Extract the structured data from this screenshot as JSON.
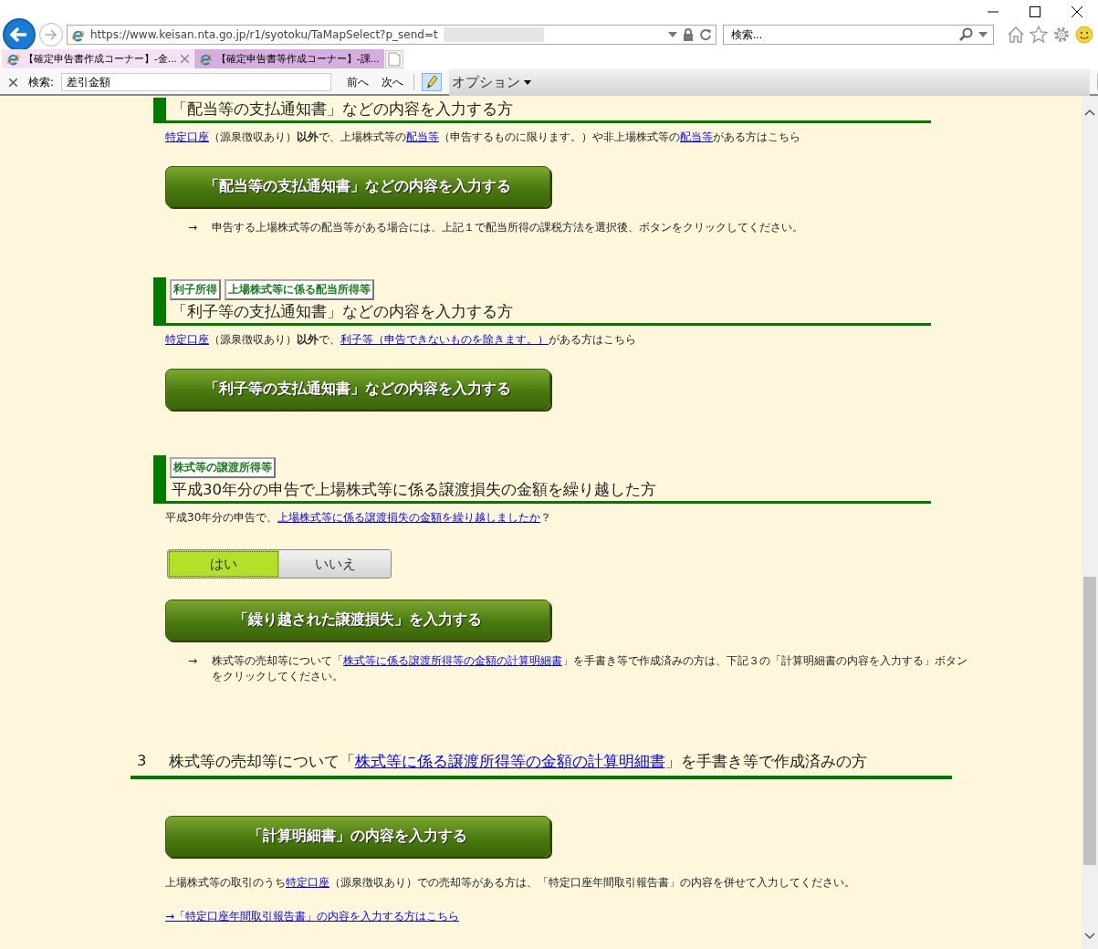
{
  "address_bar": {
    "url": "https://www.keisan.nta.go.jp/r1/syotoku/TaMapSelect?p_send=t"
  },
  "search_box": {
    "placeholder": "検索..."
  },
  "tabs": [
    {
      "title": "【確定申告書作成コーナー】-金...",
      "selected": true,
      "closable": true
    },
    {
      "title": "【確定申告書等作成コーナー】-課...",
      "selected": false,
      "closable": false
    }
  ],
  "find_bar": {
    "label": "検索:",
    "value": "差引金額",
    "prev": "前へ",
    "next": "次へ",
    "options": "オプション"
  },
  "sections": [
    {
      "blocks": [
        {
          "kind": "heading",
          "title": "「配当等の支払通知書」などの内容を入力する方"
        },
        {
          "kind": "paragraph",
          "segments": [
            {
              "kind": "link",
              "text": "特定口座"
            },
            {
              "kind": "text",
              "text": "（源泉徴収あり）"
            },
            {
              "kind": "bold",
              "text": "以外"
            },
            {
              "kind": "text",
              "text": "で、上場株式等の"
            },
            {
              "kind": "link",
              "text": "配当等"
            },
            {
              "kind": "text",
              "text": "（申告するものに限ります。）や非上場株式等の"
            },
            {
              "kind": "link",
              "text": "配当等"
            },
            {
              "kind": "text",
              "text": "がある方はこちら"
            }
          ]
        },
        {
          "kind": "button",
          "label": "「配当等の支払通知書」などの内容を入力する"
        },
        {
          "kind": "note",
          "arrow": "→",
          "segments": [
            {
              "kind": "text",
              "text": "申告する上場株式等の配当等がある場合には、上記１で配当所得の課税方法を選択後、ボタンをクリックしてください。"
            }
          ]
        }
      ]
    },
    {
      "blocks": [
        {
          "kind": "heading",
          "tags": [
            "利子所得",
            "上場株式等に係る配当所得等"
          ],
          "title": "「利子等の支払通知書」などの内容を入力する方"
        },
        {
          "kind": "paragraph",
          "segments": [
            {
              "kind": "link",
              "text": "特定口座"
            },
            {
              "kind": "text",
              "text": "（源泉徴収あり）"
            },
            {
              "kind": "bold",
              "text": "以外"
            },
            {
              "kind": "text",
              "text": "で、"
            },
            {
              "kind": "link",
              "text": "利子等（申告できないものを除きます。）"
            },
            {
              "kind": "text",
              "text": "がある方はこちら"
            }
          ]
        },
        {
          "kind": "button",
          "label": "「利子等の支払通知書」などの内容を入力する"
        }
      ]
    },
    {
      "blocks": [
        {
          "kind": "heading",
          "tags": [
            "株式等の譲渡所得等"
          ],
          "title": "平成30年分の申告で上場株式等に係る譲渡損失の金額を繰り越した方"
        },
        {
          "kind": "paragraph",
          "segments": [
            {
              "kind": "text",
              "text": "平成30年分の申告で、"
            },
            {
              "kind": "link",
              "text": "上場株式等に係る譲渡損失の金額を繰り越しましたか"
            },
            {
              "kind": "text",
              "text": "？"
            }
          ]
        },
        {
          "kind": "toggle",
          "options": [
            {
              "label": "はい",
              "selected": true
            },
            {
              "label": "いいえ",
              "selected": false
            }
          ]
        },
        {
          "kind": "button",
          "label": "「繰り越された譲渡損失」を入力する"
        },
        {
          "kind": "note",
          "arrow": "→",
          "segments": [
            {
              "kind": "text",
              "text": "株式等の売却等について「"
            },
            {
              "kind": "link",
              "text": "株式等に係る譲渡所得等の金額の計算明細書"
            },
            {
              "kind": "text",
              "text": "」を手書き等で作成済みの方は、下記３の「計算明細書の内容を入力する」ボタンをクリックしてください。"
            }
          ]
        }
      ]
    },
    {
      "blocks": [
        {
          "kind": "numbered",
          "number": "3",
          "segments": [
            {
              "kind": "text",
              "text": "株式等の売却等について「"
            },
            {
              "kind": "link",
              "text": "株式等に係る譲渡所得等の金額の計算明細書"
            },
            {
              "kind": "text",
              "text": "」を手書き等で作成済みの方"
            }
          ]
        },
        {
          "kind": "button",
          "label": "「計算明細書」の内容を入力する"
        },
        {
          "kind": "paragraph",
          "segments": [
            {
              "kind": "text",
              "text": "上場株式等の取引のうち"
            },
            {
              "kind": "link",
              "text": "特定口座"
            },
            {
              "kind": "text",
              "text": "（源泉徴収あり）での売却等がある方は、「特定口座年間取引報告書」の内容を併せて入力してください。"
            }
          ]
        },
        {
          "kind": "link",
          "text": "→「特定口座年間取引報告書」の内容を入力する方はこちら"
        }
      ]
    }
  ]
}
